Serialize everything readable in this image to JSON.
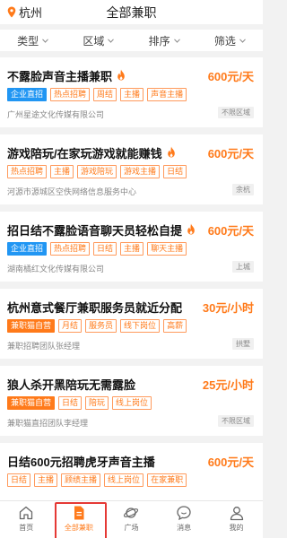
{
  "header": {
    "city": "杭州",
    "title": "全部兼职"
  },
  "filters": [
    {
      "label": "类型"
    },
    {
      "label": "区域"
    },
    {
      "label": "排序"
    },
    {
      "label": "筛选"
    }
  ],
  "jobs": [
    {
      "title": "不露脸声音主播兼职",
      "hot": true,
      "salary": "600元/天",
      "tags": [
        {
          "text": "企业直招",
          "style": "blue"
        },
        {
          "text": "热点招聘",
          "style": "outline"
        },
        {
          "text": "周结",
          "style": "outline"
        },
        {
          "text": "主播",
          "style": "outline"
        },
        {
          "text": "声音主播",
          "style": "outline"
        }
      ],
      "company": "广州星途文化传媒有限公司",
      "area": "不限区域"
    },
    {
      "title": "游戏陪玩/在家玩游戏就能赚钱",
      "hot": true,
      "salary": "600元/天",
      "tags": [
        {
          "text": "热点招聘",
          "style": "outline"
        },
        {
          "text": "主播",
          "style": "outline"
        },
        {
          "text": "游戏陪玩",
          "style": "outline"
        },
        {
          "text": "游戏主播",
          "style": "outline"
        },
        {
          "text": "日结",
          "style": "outline"
        }
      ],
      "company": "河源市源城区空佚网络信息服务中心",
      "area": "余杭"
    },
    {
      "title": "招日结不露脸语音聊天员轻松自提",
      "hot": true,
      "salary": "600元/天",
      "tags": [
        {
          "text": "企业直招",
          "style": "blue"
        },
        {
          "text": "热点招聘",
          "style": "outline"
        },
        {
          "text": "日结",
          "style": "outline"
        },
        {
          "text": "主播",
          "style": "outline"
        },
        {
          "text": "聊天主播",
          "style": "outline"
        }
      ],
      "company": "湖南橘红文化传媒有限公司",
      "area": "上城"
    },
    {
      "title": "杭州意式餐厅兼职服务员就近分配",
      "hot": false,
      "salary": "30元/小时",
      "tags": [
        {
          "text": "兼职猫自营",
          "style": "orange"
        },
        {
          "text": "月结",
          "style": "outline"
        },
        {
          "text": "服务员",
          "style": "outline"
        },
        {
          "text": "线下岗位",
          "style": "outline"
        },
        {
          "text": "高薪",
          "style": "outline"
        }
      ],
      "company": "兼职招聘团队张经理",
      "area": "拱墅"
    },
    {
      "title": "狼人杀开黑陪玩无需露脸",
      "hot": false,
      "salary": "25元/小时",
      "tags": [
        {
          "text": "兼职猫自营",
          "style": "orange"
        },
        {
          "text": "日结",
          "style": "outline"
        },
        {
          "text": "陪玩",
          "style": "outline"
        },
        {
          "text": "线上岗位",
          "style": "outline"
        }
      ],
      "company": "兼职猫直招团队李经理",
      "area": "不限区域"
    },
    {
      "title": "日结600元招聘虎牙声音主播",
      "hot": false,
      "salary": "600元/天",
      "tags": [
        {
          "text": "日结",
          "style": "outline"
        },
        {
          "text": "主播",
          "style": "outline"
        },
        {
          "text": "顾绩主播",
          "style": "outline"
        },
        {
          "text": "线上岗位",
          "style": "outline"
        },
        {
          "text": "在家兼职",
          "style": "outline"
        }
      ],
      "company": "",
      "area": ""
    }
  ],
  "tabbar": [
    {
      "label": "首页",
      "icon": "home-icon",
      "active": false
    },
    {
      "label": "全部兼职",
      "icon": "document-icon",
      "active": true
    },
    {
      "label": "广场",
      "icon": "planet-icon",
      "active": false
    },
    {
      "label": "消息",
      "icon": "message-icon",
      "active": false
    },
    {
      "label": "我的",
      "icon": "person-icon",
      "active": false
    }
  ],
  "colors": {
    "accent": "#ff7a1a",
    "blue_tag": "#2196f3",
    "active_outline": "#e53935"
  }
}
